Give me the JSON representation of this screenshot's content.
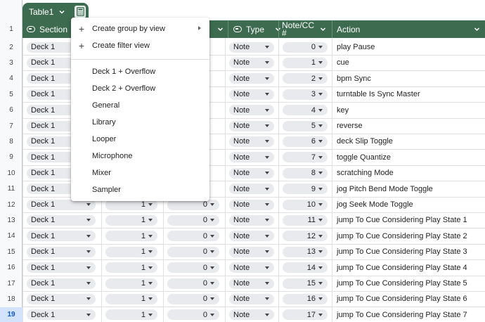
{
  "table_tab": {
    "name": "Table1",
    "chevron_icon": "chevron-down-icon",
    "calculator_icon": "calculator-icon"
  },
  "column_letters": [
    "",
    "",
    "",
    "",
    "",
    "",
    "",
    ""
  ],
  "header": {
    "row_number": "1",
    "section": "Section",
    "type": "Type",
    "note_cc_line1": "Note/CC",
    "note_cc_line2": "#",
    "action": "Action"
  },
  "rows": [
    {
      "n": "2",
      "section": "Deck 1",
      "c2": "",
      "c3": "",
      "type": "Note",
      "note": "0",
      "action": "play Pause"
    },
    {
      "n": "3",
      "section": "Deck 1",
      "c2": "",
      "c3": "",
      "type": "Note",
      "note": "1",
      "action": "cue"
    },
    {
      "n": "4",
      "section": "Deck 1",
      "c2": "",
      "c3": "",
      "type": "Note",
      "note": "2",
      "action": "bpm Sync"
    },
    {
      "n": "5",
      "section": "Deck 1",
      "c2": "",
      "c3": "",
      "type": "Note",
      "note": "3",
      "action": "turntable Is Sync Master"
    },
    {
      "n": "6",
      "section": "Deck 1",
      "c2": "",
      "c3": "",
      "type": "Note",
      "note": "4",
      "action": "key"
    },
    {
      "n": "7",
      "section": "Deck 1",
      "c2": "",
      "c3": "",
      "type": "Note",
      "note": "5",
      "action": "reverse"
    },
    {
      "n": "8",
      "section": "Deck 1",
      "c2": "",
      "c3": "",
      "type": "Note",
      "note": "6",
      "action": "deck Slip Toggle"
    },
    {
      "n": "9",
      "section": "Deck 1",
      "c2": "",
      "c3": "",
      "type": "Note",
      "note": "7",
      "action": "toggle Quantize"
    },
    {
      "n": "10",
      "section": "Deck 1",
      "c2": "",
      "c3": "",
      "type": "Note",
      "note": "8",
      "action": "scratching Mode"
    },
    {
      "n": "11",
      "section": "Deck 1",
      "c2": "",
      "c3": "",
      "type": "Note",
      "note": "9",
      "action": "jog Pitch Bend Mode Toggle"
    },
    {
      "n": "12",
      "section": "Deck 1",
      "c2": "1",
      "c3": "0",
      "type": "Note",
      "note": "10",
      "action": "jog Seek Mode Toggle"
    },
    {
      "n": "13",
      "section": "Deck 1",
      "c2": "1",
      "c3": "0",
      "type": "Note",
      "note": "11",
      "action": "jump To Cue Considering Play State 1"
    },
    {
      "n": "14",
      "section": "Deck 1",
      "c2": "1",
      "c3": "0",
      "type": "Note",
      "note": "12",
      "action": "jump To Cue Considering Play State 2"
    },
    {
      "n": "15",
      "section": "Deck 1",
      "c2": "1",
      "c3": "0",
      "type": "Note",
      "note": "13",
      "action": "jump To Cue Considering Play State 3"
    },
    {
      "n": "16",
      "section": "Deck 1",
      "c2": "1",
      "c3": "0",
      "type": "Note",
      "note": "14",
      "action": "jump To Cue Considering Play State 4"
    },
    {
      "n": "17",
      "section": "Deck 1",
      "c2": "1",
      "c3": "0",
      "type": "Note",
      "note": "15",
      "action": "jump To Cue Considering Play State 5"
    },
    {
      "n": "18",
      "section": "Deck 1",
      "c2": "1",
      "c3": "0",
      "type": "Note",
      "note": "16",
      "action": "jump To Cue Considering Play State 6"
    },
    {
      "n": "19",
      "section": "Deck 1",
      "c2": "1",
      "c3": "0",
      "type": "Note",
      "note": "17",
      "action": "jump To Cue Considering Play State 7"
    }
  ],
  "selected_row": "19",
  "menu": {
    "create_group": "Create group by view",
    "create_filter": "Create filter view",
    "views": [
      "Deck 1 + Overflow",
      "Deck 2 + Overflow",
      "General",
      "Library",
      "Looper",
      "Microphone",
      "Mixer",
      "Sampler"
    ]
  },
  "colors": {
    "header_green": "#3d6b4f",
    "chip_gray": "#e8eaed",
    "selected_row": "#d3e3fd"
  }
}
